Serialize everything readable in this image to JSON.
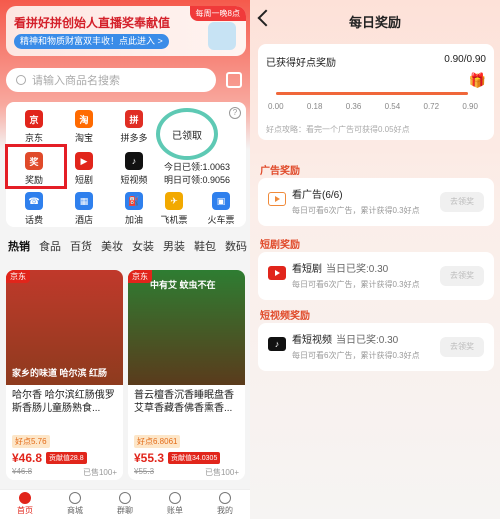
{
  "left": {
    "banner": {
      "title": "看拼好拼创始人直播奖奉献值",
      "tag": "每周一晚8点",
      "subtitle": "精神和物质财富双丰收！点此进入 >"
    },
    "search": {
      "placeholder": "请输入商品名搜索"
    },
    "grid": {
      "items": [
        {
          "label": "京东",
          "color": "#e1251b",
          "glyph": "京"
        },
        {
          "label": "淘宝",
          "color": "#ff6a00",
          "glyph": "淘"
        },
        {
          "label": "拼多多",
          "color": "#e02e24",
          "glyph": "拼"
        },
        {
          "label": "奖励",
          "color": "#e04a2a",
          "glyph": "奖"
        },
        {
          "label": "短剧",
          "color": "#e1251b",
          "glyph": "▶"
        },
        {
          "label": "短视频",
          "color": "#111111",
          "glyph": "♪"
        },
        {
          "label": "话费",
          "color": "#2f80ed",
          "glyph": "☎"
        },
        {
          "label": "酒店",
          "color": "#2f80ed",
          "glyph": "▦"
        },
        {
          "label": "加油",
          "color": "#2f80ed",
          "glyph": "⛽"
        },
        {
          "label": "飞机票",
          "color": "#f2a900",
          "glyph": "✈"
        },
        {
          "label": "火车票",
          "color": "#2f80ed",
          "glyph": "▣"
        }
      ],
      "claim_label": "已领取",
      "today": "今日已领:1.0063",
      "tomorrow": "明日可领:0.9056",
      "help_glyph": "?"
    },
    "categories": [
      "热销",
      "食品",
      "百货",
      "美妆",
      "女装",
      "男装",
      "鞋包",
      "数码",
      "电"
    ],
    "products": [
      {
        "store": "京东",
        "image_text": "家乡的味道 哈尔滨 红肠",
        "title": "哈尔香 哈尔滨红肠俄罗斯香肠儿童肠熟食...",
        "points": "好点5.76",
        "price": "¥46.8",
        "reward": "贡献值28.8",
        "old_price": "¥46.8",
        "sold": "已售100+"
      },
      {
        "store": "京东",
        "image_text": "中有艾 蚊虫不在",
        "title": "普云檀香沉香睡眠盘香艾草香藏香佛香熏香...",
        "points": "好点6.8061",
        "price": "¥55.3",
        "reward": "贡献值34.0305",
        "old_price": "¥55.3",
        "sold": "已售100+"
      }
    ],
    "tabbar": [
      "首页",
      "商城",
      "群聊",
      "账单",
      "我的"
    ]
  },
  "right": {
    "title": "每日奖励",
    "progress": {
      "label": "已获得好点奖励",
      "value": "0.90/0.90",
      "fraction": 1.0,
      "ticks": [
        "0.00",
        "0.18",
        "0.36",
        "0.54",
        "0.72",
        "0.90"
      ],
      "tip": "好点攻略：看完一个广告可获得0.05好点",
      "accent": "#f0673a"
    },
    "sections": [
      {
        "title": "广告奖励",
        "name": "看广告",
        "count": "(6/6)",
        "earned": "",
        "desc": "每日可看6次广告，累计获得0.3好点",
        "button": "去领奖",
        "icon_color": "#f08a3a"
      },
      {
        "title": "短剧奖励",
        "name": "看短剧",
        "count": "",
        "earned": "当日已奖:0.30",
        "desc": "每日可看6次广告，累计获得0.3好点",
        "button": "去领奖",
        "icon_color": "#e1251b"
      },
      {
        "title": "短视频奖励",
        "name": "看短视频",
        "count": "",
        "earned": "当日已奖:0.30",
        "desc": "每日可看6次广告，累计获得0.3好点",
        "button": "去领奖",
        "icon_color": "#111111"
      }
    ]
  }
}
